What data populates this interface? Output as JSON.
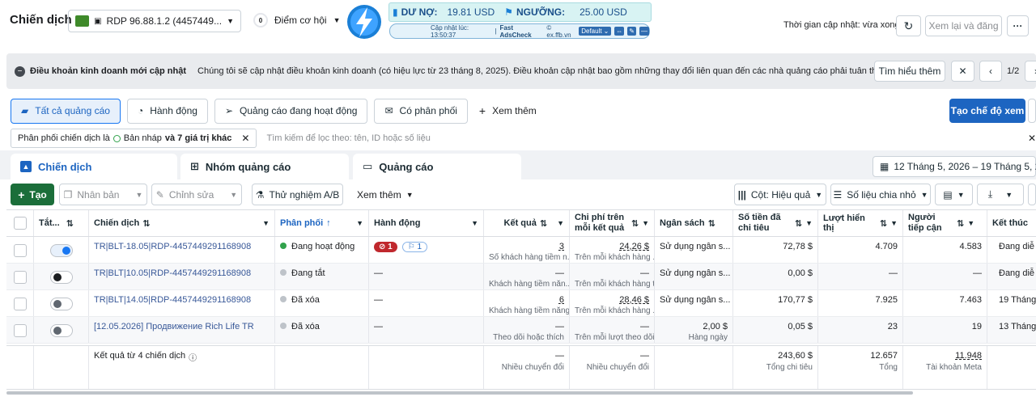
{
  "header": {
    "title": "Chiến dịch",
    "account": "RDP 96.88.1.2 (4457449...",
    "opportunity_count": "0",
    "opportunity_label": "Điểm cơ hội",
    "update_time_label": "Thời gian cập nhật: vừa xong",
    "review_publish": "Xem lại và đăng",
    "more": "···"
  },
  "fab": {
    "debt_label": "DƯ NỢ:",
    "debt_value": "19.81 USD",
    "threshold_label": "NGƯỠNG:",
    "threshold_value": "25.00 USD",
    "updated_at": "Cập nhật lúc: 13:50:37",
    "brand": "Fast AdsCheck",
    "site": "© ex.ffb.vn",
    "mode": "Default"
  },
  "notice": {
    "title": "Điều khoản kinh doanh mới cập nhật",
    "text": "Chúng tôi sẽ cập nhật điều khoản kinh doanh (có hiệu lực từ 23 tháng 8, 2025). Điều khoản cập nhật bao gồm những thay đổi liên quan đến các nhà quảng cáo phải tuân thủ luật chuyển d...",
    "learn_more": "Tìm hiểu thêm",
    "pager": "1/2"
  },
  "tabs": {
    "all_ads": "Tất cả quảng cáo",
    "actions": "Hành động",
    "active_ads": "Quảng cáo đang hoạt động",
    "delivering": "Có phân phối",
    "see_more": "Xem thêm",
    "create_view": "Tạo chế độ xem"
  },
  "filter": {
    "chip_prefix": "Phân phối chiến dịch là",
    "chip_value": "Bản nháp",
    "chip_suffix": "và 7 giá trị khác",
    "search_placeholder": "Tìm kiếm để lọc theo: tên, ID hoặc số liệu"
  },
  "levels": {
    "campaigns": "Chiến dịch",
    "adsets": "Nhóm quảng cáo",
    "ads": "Quảng cáo",
    "date_range": "12 Tháng 5, 2026 – 19 Tháng 5, 2026"
  },
  "actions": {
    "create": "Tạo",
    "duplicate": "Nhân bản",
    "edit": "Chỉnh sửa",
    "ab_test": "Thử nghiệm A/B",
    "see_more": "Xem thêm",
    "columns": "Cột: Hiệu quả",
    "breakdown": "Số liệu chia nhỏ"
  },
  "columns": {
    "toggle": "Tắt...",
    "campaign": "Chiến dịch",
    "delivery": "Phân phối",
    "actions": "Hành động",
    "results": "Kết quả",
    "cost_per_result": "Chi phí trên mỗi kết quả",
    "budget": "Ngân sách",
    "amount_spent": "Số tiền đã chi tiêu",
    "impressions": "Lượt hiển thị",
    "reach": "Người tiếp cận",
    "ends": "Kết thúc"
  },
  "rows": [
    {
      "on": true,
      "name": "TR|BLT-18.05|RDP-4457449291168908",
      "delivery": "Đang hoạt động",
      "delivery_color": "#31a24c",
      "badge_red": "1",
      "badge_blue": "1",
      "results": "3",
      "results_sub": "Số khách hàng tiềm n...",
      "cost": "24,26 $",
      "cost_sub": "Trên mỗi khách hàng ...",
      "budget": "Sử dụng ngân s...",
      "budget_sub": "",
      "spent": "72,78 $",
      "impressions": "4.709",
      "reach": "4.583",
      "ends": "Đang diễ"
    },
    {
      "on": false,
      "dark": true,
      "name": "TR|BLT|10.05|RDP-4457449291168908",
      "delivery": "Đang tắt",
      "delivery_color": "#bec3c9",
      "results": "—",
      "results_sub": "Khách hàng tiềm năn...",
      "cost": "—",
      "cost_sub": "Trên mỗi khách hàng t...",
      "budget": "Sử dụng ngân s...",
      "budget_sub": "",
      "spent": "0,00 $",
      "impressions": "—",
      "reach": "—",
      "ends": "Đang diễ"
    },
    {
      "on": false,
      "name": "TR|BLT|14.05|RDP-4457449291168908",
      "delivery": "Đã xóa",
      "delivery_color": "#bec3c9",
      "results": "6",
      "results_sub": "Khách hàng tiềm năng",
      "cost": "28,46 $",
      "cost_sub": "Trên mỗi khách hàng ...",
      "budget": "Sử dụng ngân s...",
      "budget_sub": "",
      "spent": "170,77 $",
      "impressions": "7.925",
      "reach": "7.463",
      "ends": "19 Tháng 5,"
    },
    {
      "on": false,
      "name": "[12.05.2026] Продвижение Rich Life TR",
      "delivery": "Đã xóa",
      "delivery_color": "#bec3c9",
      "results": "—",
      "results_sub": "Theo dõi hoặc thích",
      "cost": "—",
      "cost_sub": "Trên mỗi lượt theo dõi...",
      "budget": "2,00 $",
      "budget_sub": "Hàng ngày",
      "spent": "0,05 $",
      "impressions": "23",
      "reach": "19",
      "ends": "13 Tháng 5,"
    }
  ],
  "totals": {
    "label": "Kết quả từ 4 chiến dịch",
    "results": "—",
    "results_sub": "Nhiều chuyển đổi",
    "cost": "—",
    "cost_sub": "Nhiều chuyển đổi",
    "spent": "243,60 $",
    "spent_sub": "Tổng chi tiêu",
    "impressions": "12.657",
    "impressions_sub": "Tổng",
    "reach": "11.948",
    "reach_sub": "Tài khoản Meta"
  },
  "colors": {
    "primary": "#1877f2",
    "cta": "#1d65c1",
    "create_green": "#1b6e3a",
    "badge_red": "#c0282d"
  }
}
